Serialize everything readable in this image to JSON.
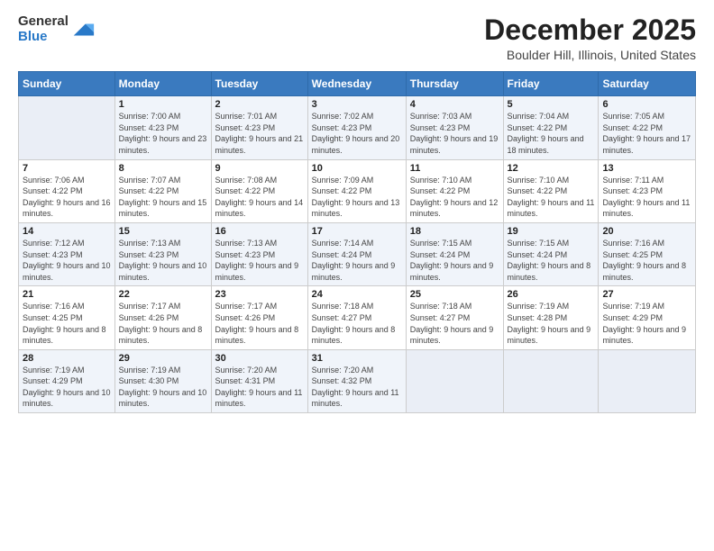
{
  "logo": {
    "general": "General",
    "blue": "Blue"
  },
  "header": {
    "title": "December 2025",
    "subtitle": "Boulder Hill, Illinois, United States"
  },
  "weekdays": [
    "Sunday",
    "Monday",
    "Tuesday",
    "Wednesday",
    "Thursday",
    "Friday",
    "Saturday"
  ],
  "weeks": [
    [
      {
        "day": "",
        "sunrise": "",
        "sunset": "",
        "daylight": ""
      },
      {
        "day": "1",
        "sunrise": "Sunrise: 7:00 AM",
        "sunset": "Sunset: 4:23 PM",
        "daylight": "Daylight: 9 hours and 23 minutes."
      },
      {
        "day": "2",
        "sunrise": "Sunrise: 7:01 AM",
        "sunset": "Sunset: 4:23 PM",
        "daylight": "Daylight: 9 hours and 21 minutes."
      },
      {
        "day": "3",
        "sunrise": "Sunrise: 7:02 AM",
        "sunset": "Sunset: 4:23 PM",
        "daylight": "Daylight: 9 hours and 20 minutes."
      },
      {
        "day": "4",
        "sunrise": "Sunrise: 7:03 AM",
        "sunset": "Sunset: 4:23 PM",
        "daylight": "Daylight: 9 hours and 19 minutes."
      },
      {
        "day": "5",
        "sunrise": "Sunrise: 7:04 AM",
        "sunset": "Sunset: 4:22 PM",
        "daylight": "Daylight: 9 hours and 18 minutes."
      },
      {
        "day": "6",
        "sunrise": "Sunrise: 7:05 AM",
        "sunset": "Sunset: 4:22 PM",
        "daylight": "Daylight: 9 hours and 17 minutes."
      }
    ],
    [
      {
        "day": "7",
        "sunrise": "Sunrise: 7:06 AM",
        "sunset": "Sunset: 4:22 PM",
        "daylight": "Daylight: 9 hours and 16 minutes."
      },
      {
        "day": "8",
        "sunrise": "Sunrise: 7:07 AM",
        "sunset": "Sunset: 4:22 PM",
        "daylight": "Daylight: 9 hours and 15 minutes."
      },
      {
        "day": "9",
        "sunrise": "Sunrise: 7:08 AM",
        "sunset": "Sunset: 4:22 PM",
        "daylight": "Daylight: 9 hours and 14 minutes."
      },
      {
        "day": "10",
        "sunrise": "Sunrise: 7:09 AM",
        "sunset": "Sunset: 4:22 PM",
        "daylight": "Daylight: 9 hours and 13 minutes."
      },
      {
        "day": "11",
        "sunrise": "Sunrise: 7:10 AM",
        "sunset": "Sunset: 4:22 PM",
        "daylight": "Daylight: 9 hours and 12 minutes."
      },
      {
        "day": "12",
        "sunrise": "Sunrise: 7:10 AM",
        "sunset": "Sunset: 4:22 PM",
        "daylight": "Daylight: 9 hours and 11 minutes."
      },
      {
        "day": "13",
        "sunrise": "Sunrise: 7:11 AM",
        "sunset": "Sunset: 4:23 PM",
        "daylight": "Daylight: 9 hours and 11 minutes."
      }
    ],
    [
      {
        "day": "14",
        "sunrise": "Sunrise: 7:12 AM",
        "sunset": "Sunset: 4:23 PM",
        "daylight": "Daylight: 9 hours and 10 minutes."
      },
      {
        "day": "15",
        "sunrise": "Sunrise: 7:13 AM",
        "sunset": "Sunset: 4:23 PM",
        "daylight": "Daylight: 9 hours and 10 minutes."
      },
      {
        "day": "16",
        "sunrise": "Sunrise: 7:13 AM",
        "sunset": "Sunset: 4:23 PM",
        "daylight": "Daylight: 9 hours and 9 minutes."
      },
      {
        "day": "17",
        "sunrise": "Sunrise: 7:14 AM",
        "sunset": "Sunset: 4:24 PM",
        "daylight": "Daylight: 9 hours and 9 minutes."
      },
      {
        "day": "18",
        "sunrise": "Sunrise: 7:15 AM",
        "sunset": "Sunset: 4:24 PM",
        "daylight": "Daylight: 9 hours and 9 minutes."
      },
      {
        "day": "19",
        "sunrise": "Sunrise: 7:15 AM",
        "sunset": "Sunset: 4:24 PM",
        "daylight": "Daylight: 9 hours and 8 minutes."
      },
      {
        "day": "20",
        "sunrise": "Sunrise: 7:16 AM",
        "sunset": "Sunset: 4:25 PM",
        "daylight": "Daylight: 9 hours and 8 minutes."
      }
    ],
    [
      {
        "day": "21",
        "sunrise": "Sunrise: 7:16 AM",
        "sunset": "Sunset: 4:25 PM",
        "daylight": "Daylight: 9 hours and 8 minutes."
      },
      {
        "day": "22",
        "sunrise": "Sunrise: 7:17 AM",
        "sunset": "Sunset: 4:26 PM",
        "daylight": "Daylight: 9 hours and 8 minutes."
      },
      {
        "day": "23",
        "sunrise": "Sunrise: 7:17 AM",
        "sunset": "Sunset: 4:26 PM",
        "daylight": "Daylight: 9 hours and 8 minutes."
      },
      {
        "day": "24",
        "sunrise": "Sunrise: 7:18 AM",
        "sunset": "Sunset: 4:27 PM",
        "daylight": "Daylight: 9 hours and 8 minutes."
      },
      {
        "day": "25",
        "sunrise": "Sunrise: 7:18 AM",
        "sunset": "Sunset: 4:27 PM",
        "daylight": "Daylight: 9 hours and 9 minutes."
      },
      {
        "day": "26",
        "sunrise": "Sunrise: 7:19 AM",
        "sunset": "Sunset: 4:28 PM",
        "daylight": "Daylight: 9 hours and 9 minutes."
      },
      {
        "day": "27",
        "sunrise": "Sunrise: 7:19 AM",
        "sunset": "Sunset: 4:29 PM",
        "daylight": "Daylight: 9 hours and 9 minutes."
      }
    ],
    [
      {
        "day": "28",
        "sunrise": "Sunrise: 7:19 AM",
        "sunset": "Sunset: 4:29 PM",
        "daylight": "Daylight: 9 hours and 10 minutes."
      },
      {
        "day": "29",
        "sunrise": "Sunrise: 7:19 AM",
        "sunset": "Sunset: 4:30 PM",
        "daylight": "Daylight: 9 hours and 10 minutes."
      },
      {
        "day": "30",
        "sunrise": "Sunrise: 7:20 AM",
        "sunset": "Sunset: 4:31 PM",
        "daylight": "Daylight: 9 hours and 11 minutes."
      },
      {
        "day": "31",
        "sunrise": "Sunrise: 7:20 AM",
        "sunset": "Sunset: 4:32 PM",
        "daylight": "Daylight: 9 hours and 11 minutes."
      },
      {
        "day": "",
        "sunrise": "",
        "sunset": "",
        "daylight": ""
      },
      {
        "day": "",
        "sunrise": "",
        "sunset": "",
        "daylight": ""
      },
      {
        "day": "",
        "sunrise": "",
        "sunset": "",
        "daylight": ""
      }
    ]
  ]
}
